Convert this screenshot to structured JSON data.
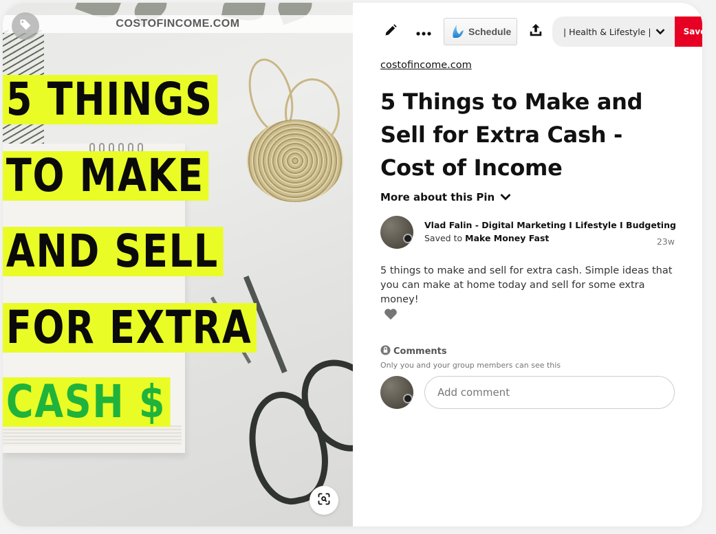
{
  "image": {
    "watermark": "COSTOFINCOME.COM",
    "headline_lines": [
      "5 THINGS",
      "TO MAKE",
      "AND SELL",
      "FOR EXTRA",
      "CASH $"
    ],
    "highlight_color": "#eafc26",
    "cash_color": "#1fb33b",
    "tag_icon": "tag-icon",
    "visual_search_icon": "visual-search-icon"
  },
  "toolbar": {
    "edit_icon": "pencil-icon",
    "more_icon": "ellipsis-icon",
    "schedule_label": "Schedule",
    "share_icon": "share-upload-icon",
    "board_selected": "| Health & Lifestyle |",
    "board_chevron": "chevron-down-icon",
    "save_label": "Save",
    "save_color": "#e60023"
  },
  "pin": {
    "source": "costofincome.com",
    "title": "5 Things to Make and Sell for Extra Cash - Cost of Income",
    "more_about": "More about this Pin",
    "pinner_name": "Vlad Falin - Digital Marketing I Lifestyle I Budgeting",
    "saved_to_prefix": "Saved to",
    "board_name": "Make Money Fast",
    "age": "23w",
    "description": "5 things to make and sell for extra cash. Simple ideas that you can make at home today and sell for some extra money!"
  },
  "comments": {
    "heading": "Comments",
    "privacy_note": "Only you and your group members can see this",
    "placeholder": "Add comment"
  }
}
